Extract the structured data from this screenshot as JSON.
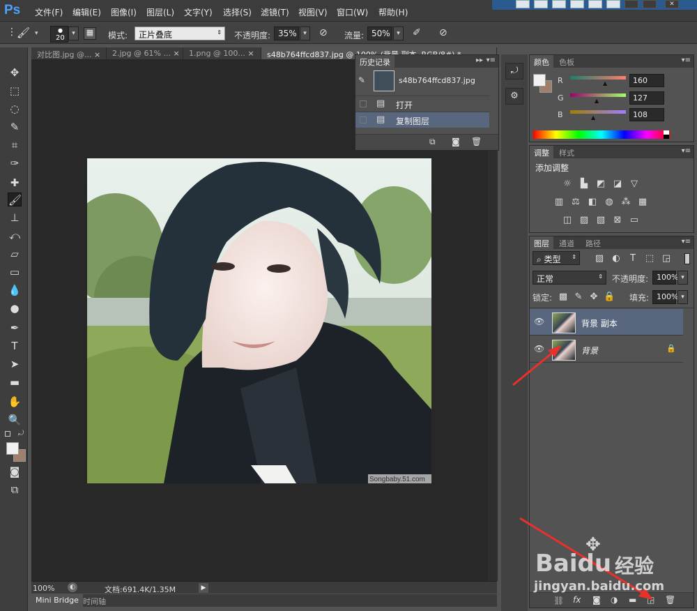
{
  "app": {
    "logo": "Ps"
  },
  "menu": [
    "文件(F)",
    "编辑(E)",
    "图像(I)",
    "图层(L)",
    "文字(Y)",
    "选择(S)",
    "滤镜(T)",
    "视图(V)",
    "窗口(W)",
    "帮助(H)"
  ],
  "options": {
    "brush_size": "20",
    "mode_label": "模式:",
    "mode_value": "正片叠底",
    "opacity_label": "不透明度:",
    "opacity_value": "35%",
    "flow_label": "流量:",
    "flow_value": "50%"
  },
  "doc_tabs": [
    {
      "label": "对比图.jpg @..."
    },
    {
      "label": "2.jpg @ 61% ..."
    },
    {
      "label": "1.png @ 100..."
    },
    {
      "label": "s48b764ffcd837.jpg @ 100% (背景 副本, RGB/8#) *"
    }
  ],
  "status": {
    "zoom": "100%",
    "doc": "文档:691.4K/1.35M"
  },
  "bottom_tabs": [
    "Mini Bridge",
    "时间轴"
  ],
  "photo": {
    "watermark": "Songbaby.51.com"
  },
  "history": {
    "title": "历史记录",
    "snapshot": "s48b764ffcd837.jpg",
    "items": [
      {
        "label": "打开",
        "selected": false
      },
      {
        "label": "复制图层",
        "selected": true
      }
    ]
  },
  "color_panel": {
    "tabs": [
      "颜色",
      "色板"
    ],
    "r_label": "R",
    "g_label": "G",
    "b_label": "B",
    "r": "160",
    "g": "127",
    "b": "108",
    "foreground": "#f1f1f1",
    "background": "#a07f6c"
  },
  "adjust_panel": {
    "tabs": [
      "调整",
      "样式"
    ],
    "title": "添加调整"
  },
  "layers_panel": {
    "tabs": [
      "图层",
      "通道",
      "路径"
    ],
    "filter_type": "类型",
    "blend_mode": "正常",
    "opacity_label": "不透明度:",
    "opacity": "100%",
    "lock_label": "锁定:",
    "fill_label": "填充:",
    "fill": "100%",
    "layers": [
      {
        "name": "背景 副本",
        "selected": true,
        "locked": false
      },
      {
        "name": "背景",
        "selected": false,
        "locked": true
      }
    ]
  },
  "watermark": {
    "brand": "Baidu",
    "cn": "经验",
    "url": "jingyan.baidu.com"
  },
  "icons": {
    "accent": "#4aa3ff",
    "annotation_arrow": "#e8312b",
    "selection_highlight": "#58677d"
  }
}
